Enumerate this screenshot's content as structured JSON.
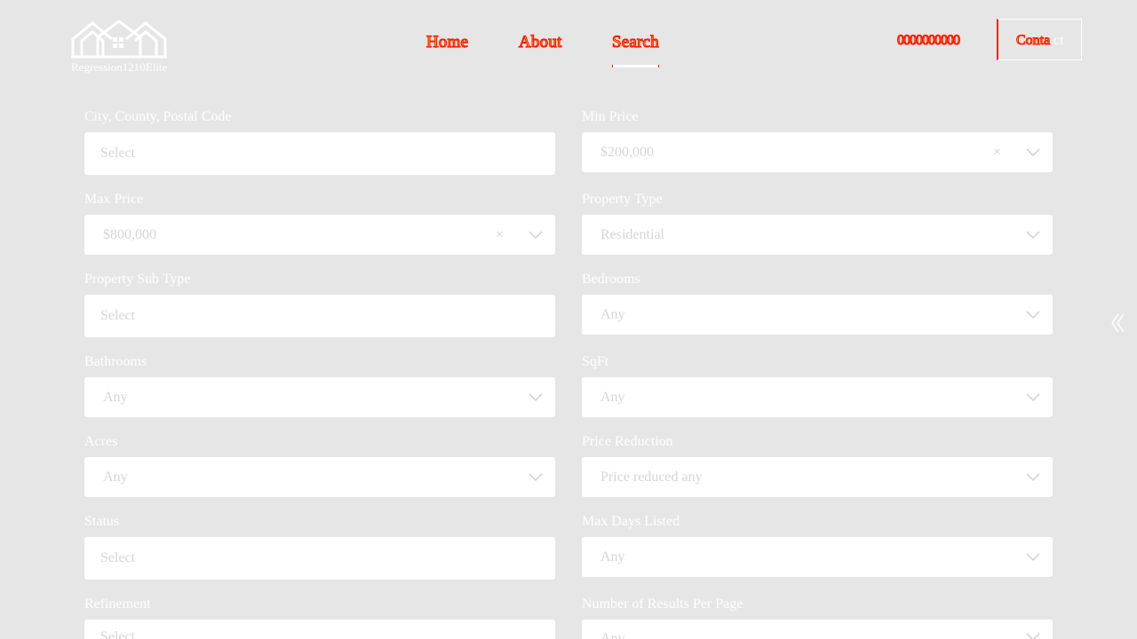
{
  "header": {
    "logo_text": "Regression1210Elite",
    "nav": [
      {
        "label": "Home"
      },
      {
        "label": "About"
      },
      {
        "label": "Search"
      }
    ],
    "phone": "0000000000",
    "contact_label": "Conta",
    "contact_tail": "ct"
  },
  "form": {
    "city": {
      "label": "City, County, Postal Code",
      "placeholder": "Select"
    },
    "min_price": {
      "label": "Min Price",
      "value": "$200,000"
    },
    "max_price": {
      "label": "Max Price",
      "value": "$800,000"
    },
    "property_type": {
      "label": "Property Type",
      "value": "Residential"
    },
    "property_sub_type": {
      "label": "Property Sub Type",
      "placeholder": "Select"
    },
    "bedrooms": {
      "label": "Bedrooms",
      "value": "Any"
    },
    "bathrooms": {
      "label": "Bathrooms",
      "value": "Any"
    },
    "sqft": {
      "label": "SqFt",
      "value": "Any"
    },
    "acres": {
      "label": "Acres",
      "value": "Any"
    },
    "price_reduction": {
      "label": "Price Reduction",
      "value": "Price reduced any"
    },
    "status": {
      "label": "Status",
      "placeholder": "Select"
    },
    "max_days_listed": {
      "label": "Max Days Listed",
      "value": "Any"
    },
    "refinement": {
      "label": "Refinement",
      "placeholder": "Select"
    },
    "results_per_page": {
      "label": "Number of Results Per Page",
      "value": "Any"
    }
  },
  "icons": {
    "clear": "×",
    "chevron": "chevron-down-icon",
    "side": "double-chevron-left-icon",
    "logo": "house-logo-icon"
  }
}
